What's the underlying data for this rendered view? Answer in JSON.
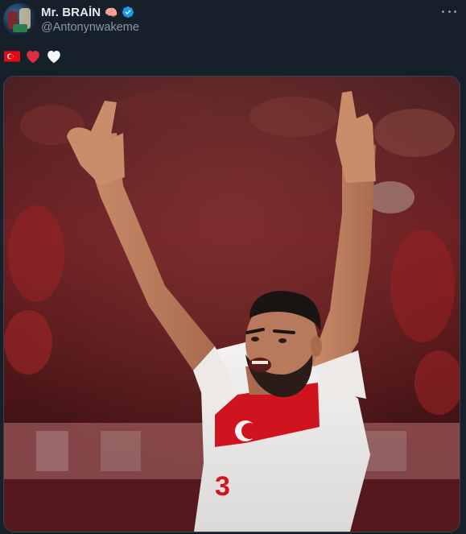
{
  "tweet": {
    "author": {
      "display_name": "Mr. BRAİN",
      "name_emoji": "🧠",
      "handle": "@Antonynwakeme",
      "verified": true,
      "avatar_icon": "avatar-image"
    },
    "more_icon": "more-options-icon",
    "body": {
      "emojis": [
        "turkey-flag-icon",
        "red-heart-icon",
        "white-heart-icon"
      ]
    },
    "media": {
      "jersey_number": "3"
    }
  },
  "colors": {
    "background": "#15202b",
    "verified": "#1d9bf0",
    "handle": "#8b98a5",
    "turkey_red": "#e30a17"
  }
}
